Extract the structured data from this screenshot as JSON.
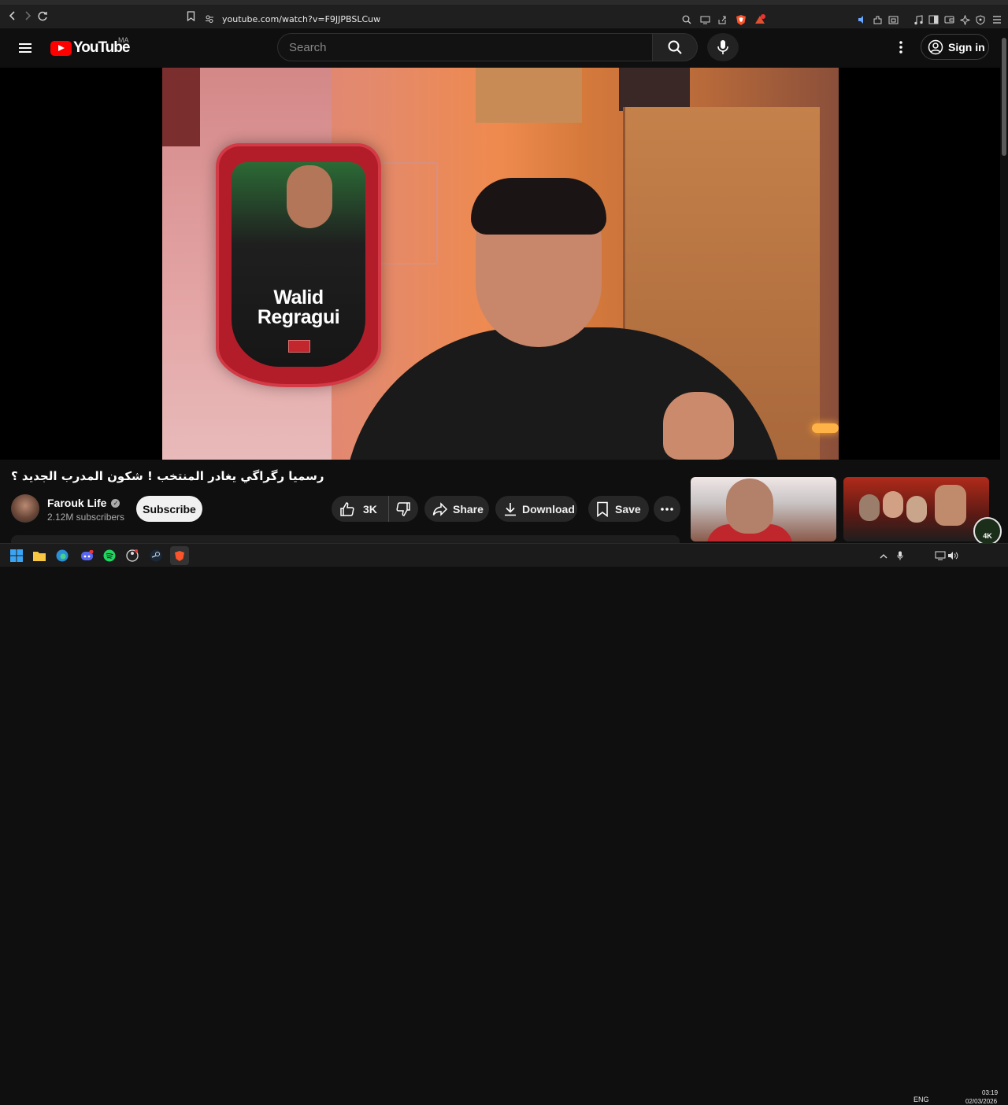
{
  "browser": {
    "url": "youtube.com/watch?v=F9JJPBSLCuw"
  },
  "header": {
    "logo_text": "YouTube",
    "country_code": "MA",
    "search_placeholder": "Search",
    "sign_in_label": "Sign in"
  },
  "video": {
    "card_name_line1": "Walid",
    "card_name_line2": "Regragui",
    "title": "رسميا رگراگي يغادر المنتخب ! شكون المدرب الجديد ؟"
  },
  "channel": {
    "name": "Farouk Life",
    "subscribers": "2.12M subscribers",
    "subscribe_label": "Subscribe"
  },
  "actions": {
    "like_count": "3K",
    "share_label": "Share",
    "download_label": "Download",
    "save_label": "Save"
  },
  "recommendations": {
    "badge_text": "4K"
  },
  "taskbar": {
    "language": "ENG",
    "time": "03:19",
    "date": "02/03/2026"
  },
  "colors": {
    "brand_red": "#ff0000",
    "background": "#0f0f0f",
    "pill_bg": "#272727"
  }
}
